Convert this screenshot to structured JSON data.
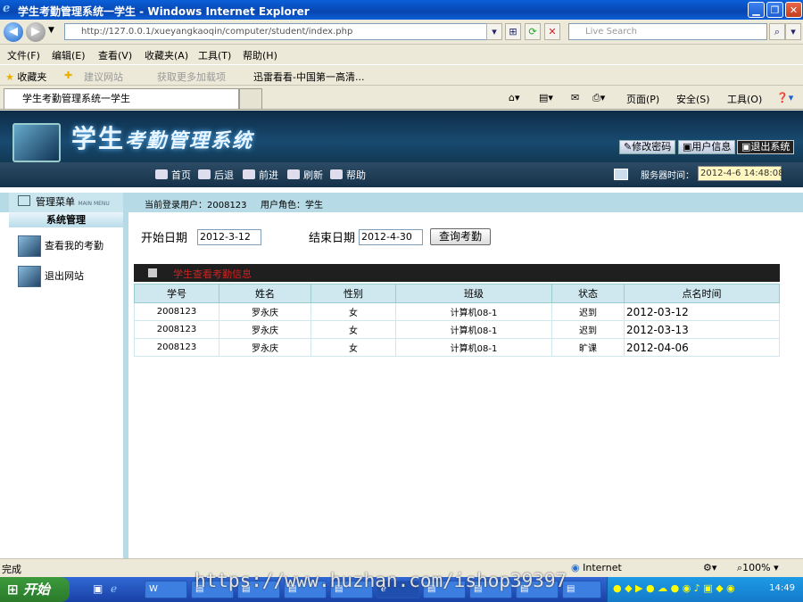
{
  "window": {
    "title": "学生考勤管理系统一学生 - Windows Internet Explorer"
  },
  "browser": {
    "address": "http://127.0.0.1/xueyangkaoqin/computer/student/index.php",
    "search_placeholder": "Live Search",
    "menu": [
      "文件(F)",
      "编辑(E)",
      "查看(V)",
      "收藏夹(A)",
      "工具(T)",
      "帮助(H)"
    ],
    "favorites_label": "收藏夹",
    "favorites": [
      "建议网站",
      "获取更多加载项",
      "迅雷看看-中国第一高清..."
    ],
    "tab_title": "学生考勤管理系统一学生",
    "commands": [
      "页面(P)",
      "安全(S)",
      "工具(O)"
    ]
  },
  "site": {
    "logo": "学生",
    "logo_sub": "考勤管理系统",
    "top_buttons": [
      "修改密码",
      "用户信息",
      "退出系统"
    ],
    "nav": [
      "首页",
      "后退",
      "前进",
      "刷新",
      "帮助"
    ],
    "server_time_label": "服务器时间：",
    "server_time": "2012-4-6 14:48:08",
    "sidebar_header": "管理菜单",
    "sidebar_header_en": "MAIN MENU",
    "sidebar_section": "系统管理",
    "sidebar_items": [
      "查看我的考勤",
      "退出网站"
    ],
    "current_user": "当前登录用户：2008123",
    "user_role": "用户角色：学生"
  },
  "query": {
    "start_label": "开始日期",
    "start_value": "2012-3-12",
    "end_label": "结束日期",
    "end_value": "2012-4-30",
    "button": "查询考勤"
  },
  "table": {
    "title": "学生查看考勤信息",
    "headers": [
      "学号",
      "姓名",
      "性别",
      "班级",
      "状态",
      "点名时间"
    ],
    "rows": [
      [
        "2008123",
        "罗永庆",
        "女",
        "计算机08-1",
        "迟到",
        "2012-03-12"
      ],
      [
        "2008123",
        "罗永庆",
        "女",
        "计算机08-1",
        "迟到",
        "2012-03-13"
      ],
      [
        "2008123",
        "罗永庆",
        "女",
        "计算机08-1",
        "旷课",
        "2012-04-06"
      ]
    ]
  },
  "status": {
    "left": "完成",
    "zone": "Internet",
    "zoom": "100%"
  },
  "taskbar": {
    "start": "开始",
    "clock": "14:49"
  },
  "watermark": "https://www.huzhan.com/ishop39397",
  "colors": {
    "titlebar": "#0846b0",
    "banner": "#184a70",
    "accent_light": "#b7dbe6",
    "table_title": "#cc2222"
  }
}
